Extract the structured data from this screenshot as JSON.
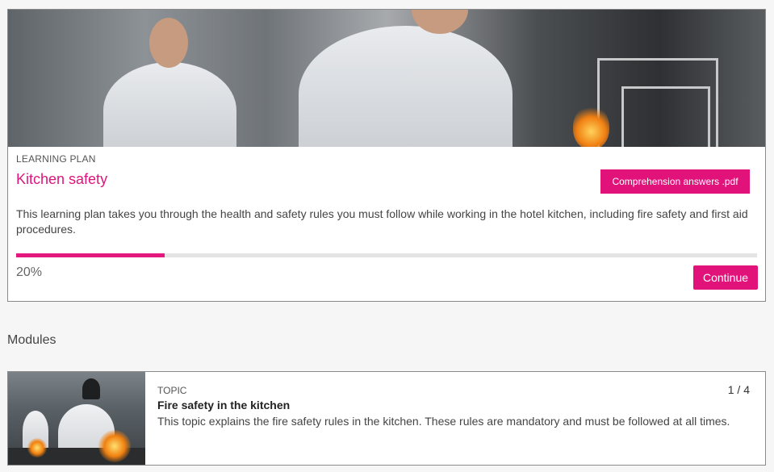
{
  "learning_plan": {
    "eyebrow": "LEARNING PLAN",
    "title": "Kitchen safety",
    "attachment_label": "Comprehension answers .pdf",
    "description": "This learning plan takes you through the health and safety rules you must follow while working in the hotel kitchen, including fire safety and first aid procedures.",
    "progress_fraction": 0.2,
    "progress_text": "20%",
    "continue_label": "Continue"
  },
  "modules_section": {
    "heading": "Modules",
    "items": [
      {
        "eyebrow": "TOPIC",
        "title": "Fire safety in the kitchen",
        "count": "1 / 4",
        "description": "This topic explains the fire safety rules in the kitchen. These rules are mandatory and must be followed at all times."
      }
    ]
  },
  "colors": {
    "accent": "#e2127b",
    "progress_track": "#e4e4e4",
    "page_background": "#f6f6f6"
  }
}
